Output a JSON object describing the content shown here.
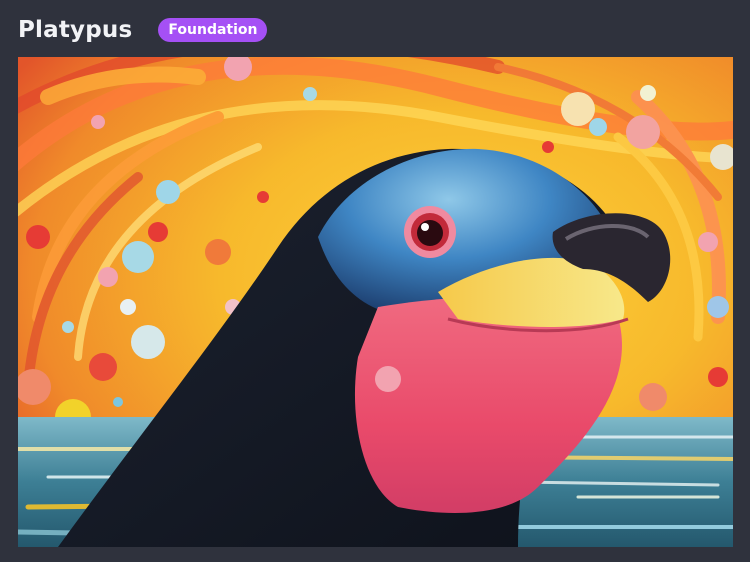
{
  "header": {
    "title": "Platypus",
    "badge": "Foundation"
  },
  "colors": {
    "background": "#2f323d",
    "badge": "#a550f5",
    "title_text": "#f2f3f6"
  },
  "artwork": {
    "subject": "platypus-painting"
  }
}
